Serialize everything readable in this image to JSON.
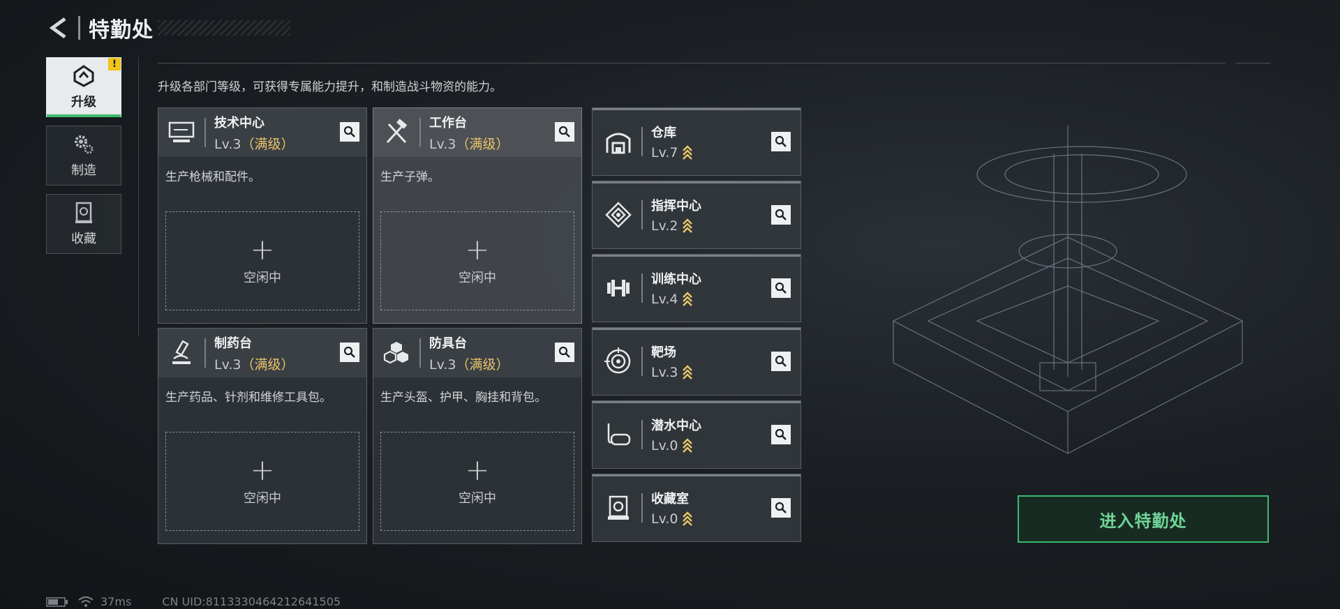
{
  "header": {
    "title": "特勤处"
  },
  "sidebar": {
    "tabs": [
      {
        "label": "升级",
        "icon": "upgrade-icon",
        "active": true,
        "notice": "!"
      },
      {
        "label": "制造",
        "icon": "gears-icon",
        "active": false
      },
      {
        "label": "收藏",
        "icon": "collection-icon",
        "active": false
      }
    ]
  },
  "description": "升级各部门等级，可获得专属能力提升，和制造战斗物资的能力。",
  "production_cards": [
    {
      "name": "技术中心",
      "level": "Lv.3",
      "status": "（满级）",
      "desc": "生产枪械和配件。",
      "slot_label": "空闲中",
      "icon": "monitor-icon"
    },
    {
      "name": "工作台",
      "level": "Lv.3",
      "status": "（满级）",
      "desc": "生产子弹。",
      "slot_label": "空闲中",
      "icon": "tools-icon"
    },
    {
      "name": "制药台",
      "level": "Lv.3",
      "status": "（满级）",
      "desc": "生产药品、针剂和维修工具包。",
      "slot_label": "空闲中",
      "icon": "microscope-icon"
    },
    {
      "name": "防具台",
      "level": "Lv.3",
      "status": "（满级）",
      "desc": "生产头盔、护甲、胸挂和背包。",
      "slot_label": "空闲中",
      "icon": "cubes-icon"
    }
  ],
  "facilities": [
    {
      "name": "仓库",
      "level": "Lv.7",
      "icon": "warehouse-icon"
    },
    {
      "name": "指挥中心",
      "level": "Lv.2",
      "icon": "command-icon"
    },
    {
      "name": "训练中心",
      "level": "Lv.4",
      "icon": "dumbbell-icon"
    },
    {
      "name": "靶场",
      "level": "Lv.3",
      "icon": "target-icon"
    },
    {
      "name": "潜水中心",
      "level": "Lv.0",
      "icon": "diving-icon"
    },
    {
      "name": "收藏室",
      "level": "Lv.0",
      "icon": "showcase-icon"
    }
  ],
  "enter_button": {
    "label": "进入特勤处"
  },
  "status": {
    "ping": "37ms",
    "uid": "CN UID:8113330464212641505"
  },
  "colors": {
    "accent_green": "#3dba6e",
    "maxed_gold": "#e9c46a",
    "upgrade_chevron": "#e9c46a"
  }
}
